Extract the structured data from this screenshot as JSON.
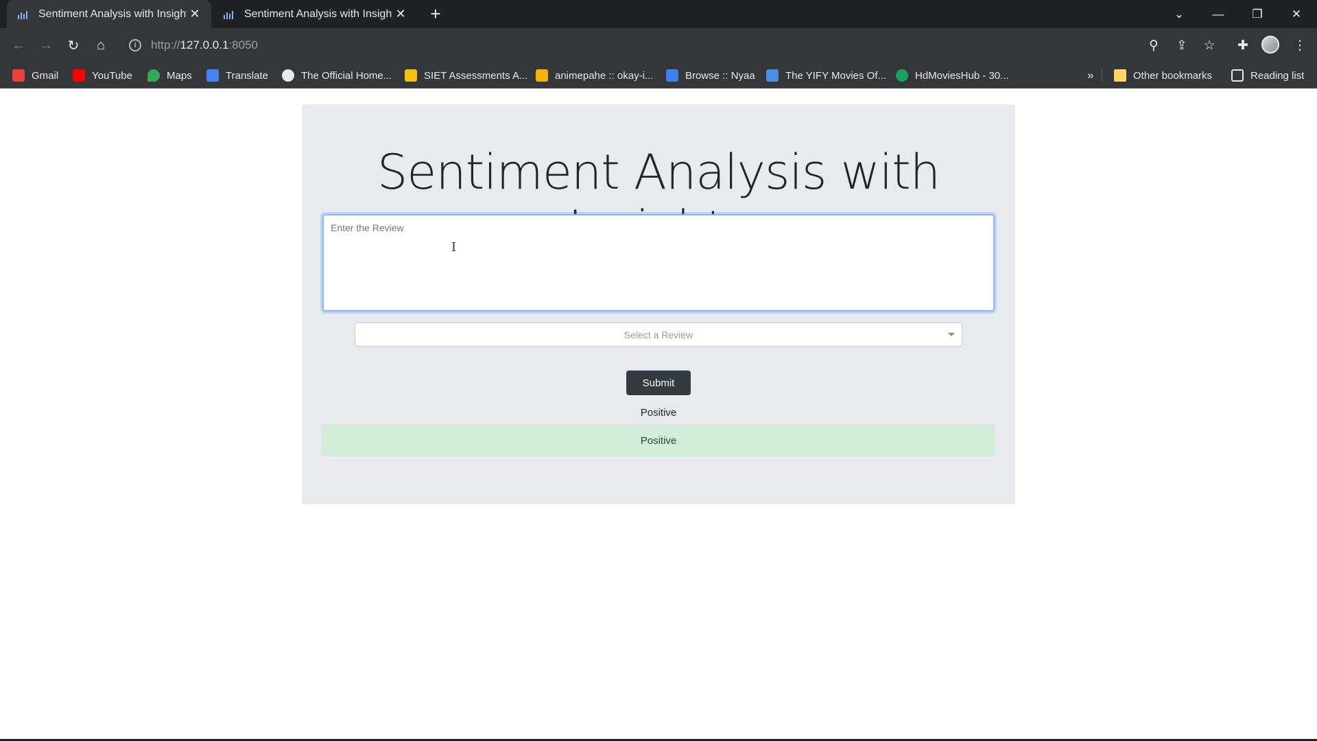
{
  "browser": {
    "tabs": [
      {
        "title": "Sentiment Analysis with Insights",
        "active": true
      },
      {
        "title": "Sentiment Analysis with Insights",
        "active": false
      }
    ],
    "url_scheme": "http://",
    "url_host": "127.0.0.1",
    "url_port": ":8050",
    "bookmarks": [
      {
        "label": "Gmail",
        "color": "#ea4335"
      },
      {
        "label": "YouTube",
        "color": "#ff0000"
      },
      {
        "label": "Maps",
        "color": "#34a853"
      },
      {
        "label": "Translate",
        "color": "#4285f4"
      },
      {
        "label": "The Official Home...",
        "color": "#e8eaed"
      },
      {
        "label": "SIET Assessments A...",
        "color": "#f4c20d"
      },
      {
        "label": "animepahe :: okay-i...",
        "color": "#f4b400"
      },
      {
        "label": "Browse :: Nyaa",
        "color": "#3b82f6"
      },
      {
        "label": "The YIFY Movies Of...",
        "color": "#4a90e2"
      },
      {
        "label": "HdMoviesHub - 30...",
        "color": "#1aa260"
      }
    ],
    "overflow_label": "»",
    "other_bookmarks": "Other bookmarks",
    "reading_list": "Reading list"
  },
  "app": {
    "title": "Sentiment Analysis with Insights",
    "review_placeholder": "Enter the Review",
    "select_placeholder": "Select a Review",
    "submit_label": "Submit",
    "result_text": "Positive",
    "result_alert": "Positive",
    "colors": {
      "panel_bg": "#e9eaed",
      "submit_bg": "#343a40",
      "alert_bg": "#d4eddb",
      "alert_text": "#155724"
    }
  }
}
